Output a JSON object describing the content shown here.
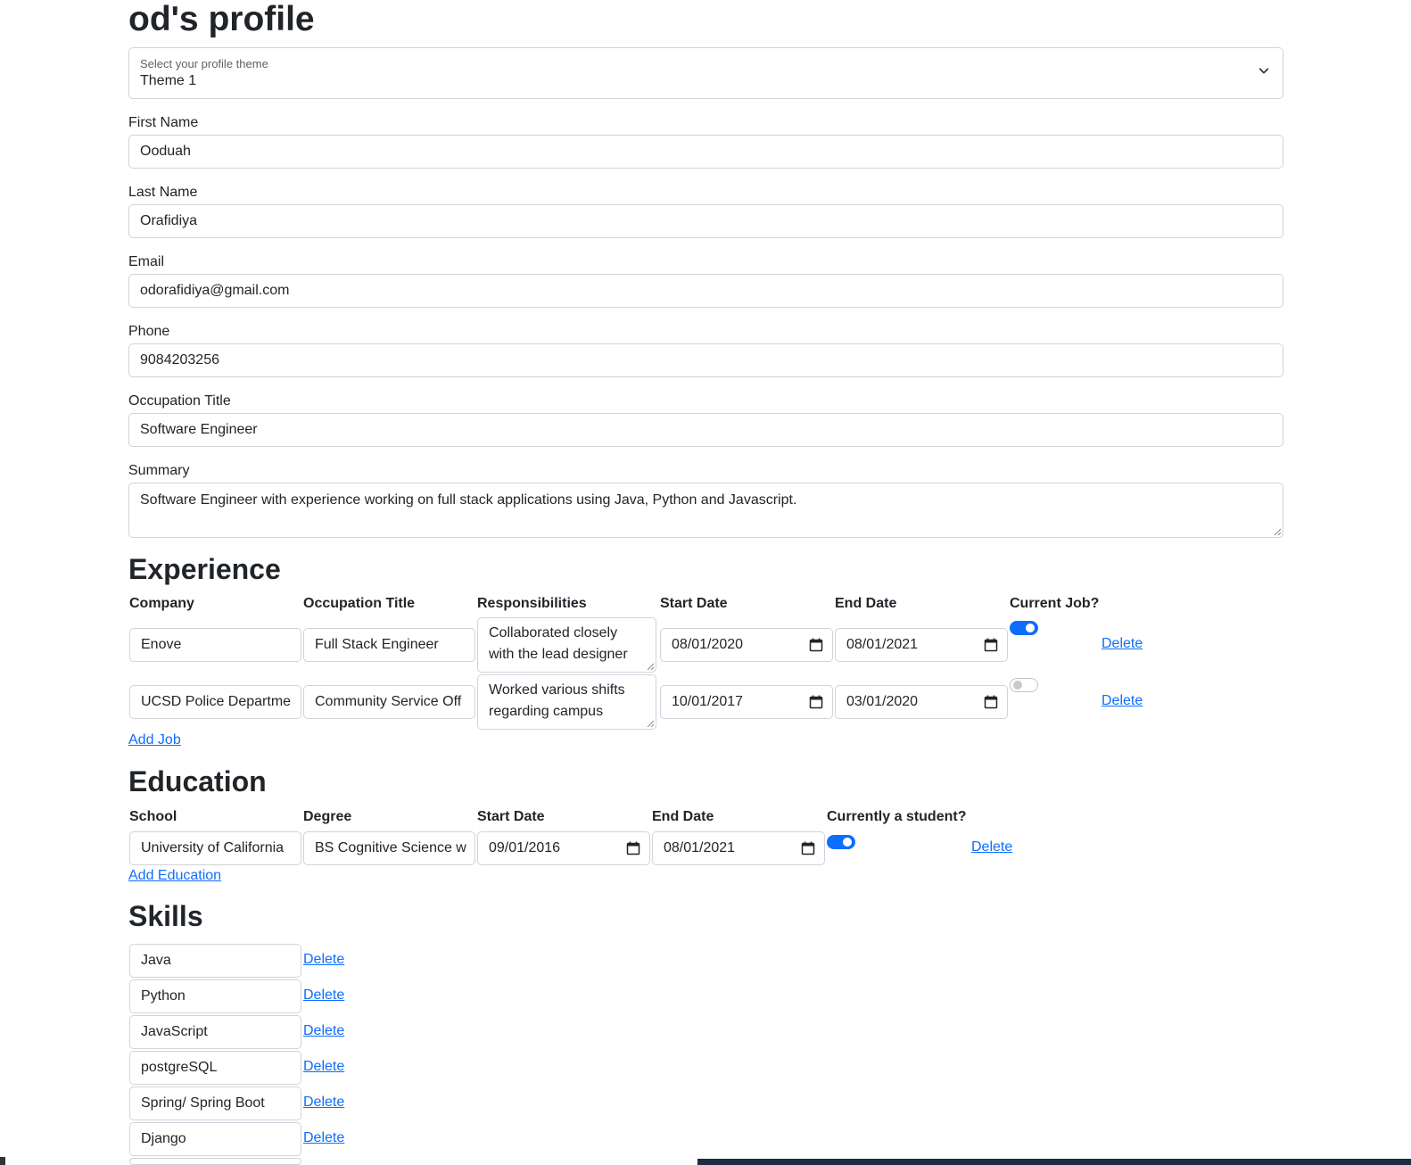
{
  "page_title": "od's profile",
  "theme": {
    "label": "Select your profile theme",
    "value": "Theme 1"
  },
  "fields": {
    "first_name": {
      "label": "First Name",
      "value": "Ooduah"
    },
    "last_name": {
      "label": "Last Name",
      "value": "Orafidiya"
    },
    "email": {
      "label": "Email",
      "value": "odorafidiya@gmail.com"
    },
    "phone": {
      "label": "Phone",
      "value": "9084203256"
    },
    "occupation": {
      "label": "Occupation Title",
      "value": "Software Engineer"
    },
    "summary": {
      "label": "Summary",
      "value": "Software Engineer with experience working on full stack applications using Java, Python and Javascript."
    }
  },
  "experience": {
    "heading": "Experience",
    "columns": {
      "company": "Company",
      "title": "Occupation Title",
      "responsibilities": "Responsibilities",
      "start": "Start Date",
      "end": "End Date",
      "current": "Current Job?"
    },
    "rows": [
      {
        "company": "Enove",
        "title": "Full Stack Engineer",
        "responsibilities": "Collaborated closely with the lead designer",
        "start": "08/01/2020",
        "end": "08/01/2021",
        "current": true,
        "delete_label": "Delete"
      },
      {
        "company": "UCSD Police Departme",
        "title": "Community Service Off",
        "responsibilities": "Worked various shifts regarding campus",
        "start": "10/01/2017",
        "end": "03/01/2020",
        "current": false,
        "delete_label": "Delete"
      }
    ],
    "add_label": "Add Job"
  },
  "education": {
    "heading": "Education",
    "columns": {
      "school": "School",
      "degree": "Degree",
      "start": "Start Date",
      "end": "End Date",
      "current": "Currently a student?"
    },
    "rows": [
      {
        "school": "University of California",
        "degree": "BS Cognitive Science w",
        "start": "09/01/2016",
        "end": "08/01/2021",
        "current": true,
        "delete_label": "Delete"
      }
    ],
    "add_label": "Add Education"
  },
  "skills": {
    "heading": "Skills",
    "items": [
      {
        "name": "Java",
        "delete_label": "Delete"
      },
      {
        "name": "Python",
        "delete_label": "Delete"
      },
      {
        "name": "JavaScript",
        "delete_label": "Delete"
      },
      {
        "name": "postgreSQL",
        "delete_label": "Delete"
      },
      {
        "name": "Spring/ Spring Boot",
        "delete_label": "Delete"
      },
      {
        "name": "Django",
        "delete_label": "Delete"
      }
    ]
  },
  "colors": {
    "link": "#0d6efd",
    "border": "#ced4da",
    "switch_on": "#0d6efd"
  }
}
